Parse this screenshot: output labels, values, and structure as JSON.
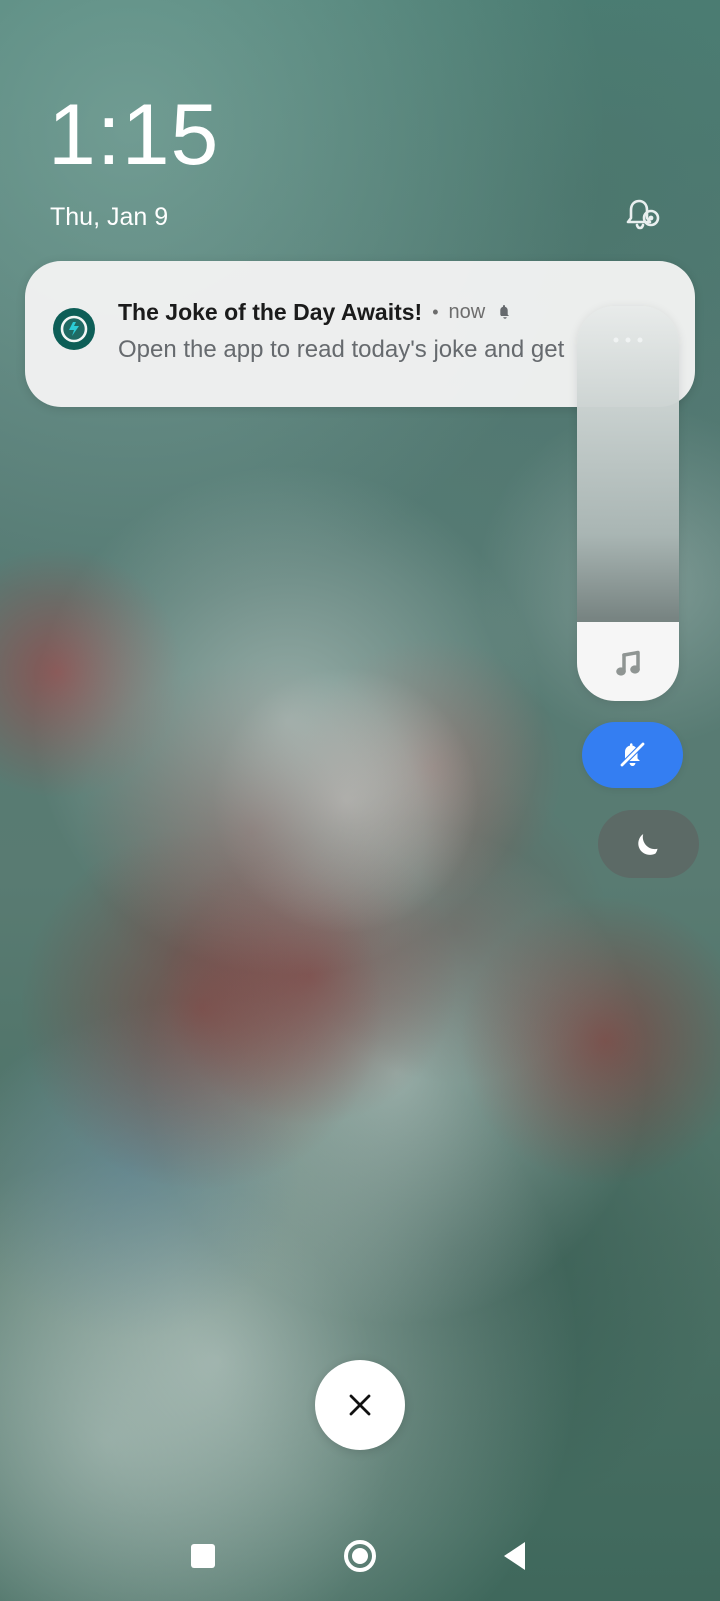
{
  "lockscreen": {
    "time": "1:15",
    "date": "Thu, Jan 9"
  },
  "notification": {
    "title": "The Joke of the Day Awaits!",
    "separator": "•",
    "time": "now",
    "body": "Open the app to read today's joke and get",
    "icons": {
      "app": "app-icon",
      "alert": "bell-icon",
      "settings": "notification-settings-icon"
    }
  },
  "volume_panel": {
    "more_icon": "more-horizontal-icon",
    "level_fraction": 0.2,
    "music_icon": "music-note-icon",
    "mute_icon": "bell-off-icon",
    "dnd_icon": "moon-icon",
    "accent_color": "#347ef2"
  },
  "overlay": {
    "close_icon": "close-icon"
  },
  "nav_bar": {
    "recent_icon": "square-icon",
    "home_icon": "home-circle-icon",
    "back_icon": "back-triangle-icon"
  }
}
